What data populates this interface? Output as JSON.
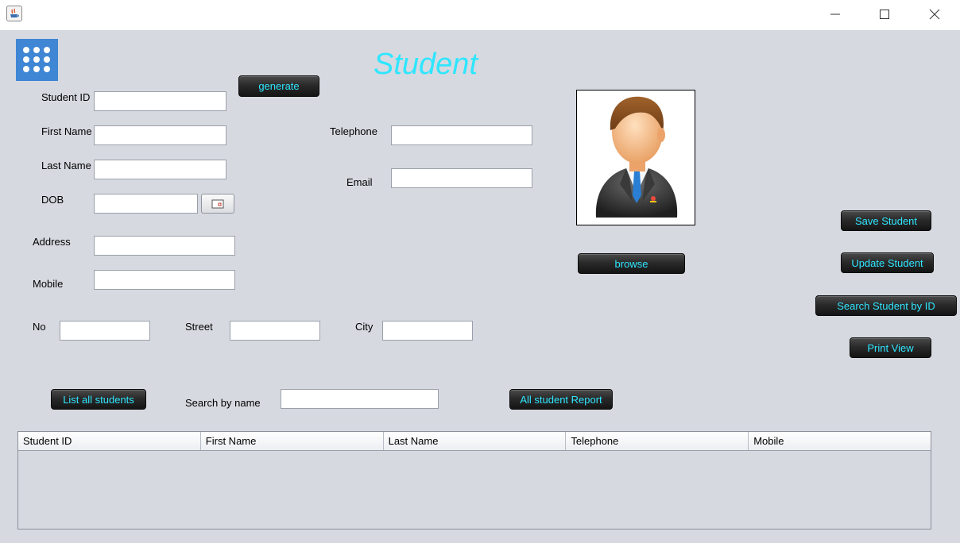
{
  "window": {
    "minimize_glyph": "—",
    "maximize_glyph": "☐",
    "close_glyph": "✕"
  },
  "header": {
    "title": "Student",
    "generate_label": "generate"
  },
  "form": {
    "student_id_label": "Student ID",
    "first_name_label": "First Name",
    "last_name_label": "Last Name",
    "dob_label": "DOB",
    "address_label": "Address",
    "mobile_label": "Mobile",
    "telephone_label": "Telephone",
    "email_label": "Email",
    "no_label": "No",
    "street_label": "Street",
    "city_label": "City",
    "student_id": "",
    "first_name": "",
    "last_name": "",
    "dob": "",
    "address": "",
    "mobile": "",
    "telephone": "",
    "email": "",
    "no": "",
    "street": "",
    "city": ""
  },
  "photo": {
    "browse_label": "browse"
  },
  "actions": {
    "save_label": "Save Student",
    "update_label": "Update Student",
    "search_id_label": "Search Student by ID",
    "print_label": "Print View"
  },
  "search": {
    "list_all_label": "List all students",
    "search_by_name_label": "Search by name",
    "search_value": "",
    "report_label": "All student Report"
  },
  "table": {
    "columns": [
      "Student ID",
      "First Name",
      "Last Name",
      "Telephone",
      "Mobile"
    ],
    "rows": []
  },
  "colors": {
    "background": "#d6d9e0",
    "accent_text": "#2ee6ff",
    "menu_icon": "#3f86d4"
  }
}
